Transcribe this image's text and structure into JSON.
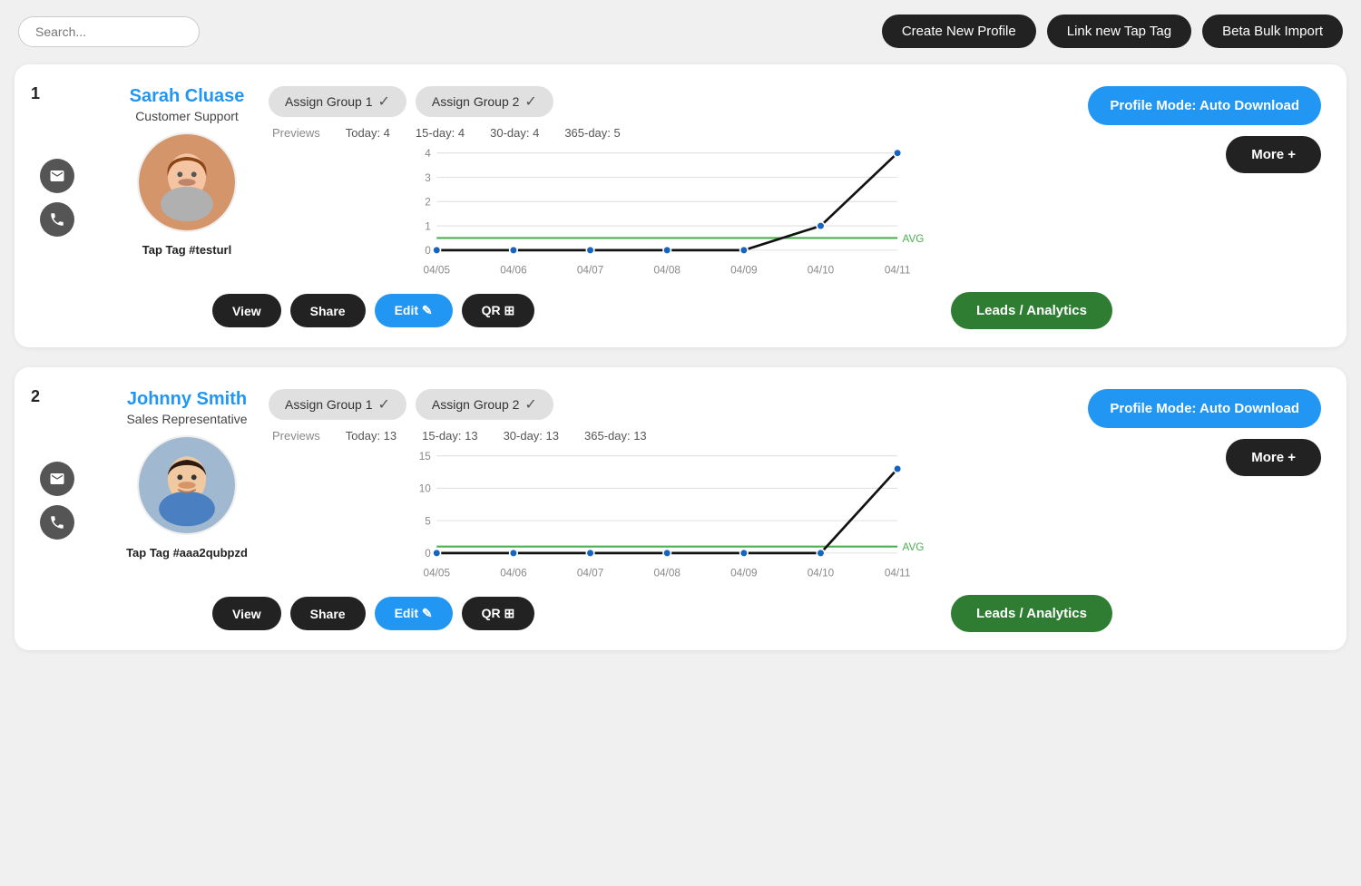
{
  "header": {
    "search_placeholder": "Search...",
    "btn_create": "Create New Profile",
    "btn_link": "Link new Tap Tag",
    "btn_bulk": "Beta Bulk Import"
  },
  "profiles": [
    {
      "number": "1",
      "name": "Sarah Cluase",
      "title": "Customer Support",
      "tap_tag": "Tap Tag #testurl",
      "group1": "Assign Group 1",
      "group2": "Assign Group 2",
      "stats": {
        "label": "Previews",
        "today": "Today: 4",
        "day15": "15-day: 4",
        "day30": "30-day: 4",
        "day365": "365-day: 5"
      },
      "profile_mode": "Profile Mode: Auto Download",
      "more": "More +",
      "btn_view": "View",
      "btn_share": "Share",
      "btn_edit": "Edit ✎",
      "btn_qr": "QR ⊞",
      "btn_leads": "Leads / Analytics",
      "chart": {
        "dates": [
          "04/05",
          "04/06",
          "04/07",
          "04/08",
          "04/09",
          "04/10",
          "04/11"
        ],
        "values": [
          0,
          0,
          0,
          0,
          0,
          1,
          4
        ],
        "avg": 0.5,
        "max": 4,
        "avg_label": "AVG"
      },
      "avatar_color": "#c8956c",
      "avatar_type": "woman"
    },
    {
      "number": "2",
      "name": "Johnny Smith",
      "title": "Sales Representative",
      "tap_tag": "Tap Tag #aaa2qubpzd",
      "group1": "Assign Group 1",
      "group2": "Assign Group 2",
      "stats": {
        "label": "Previews",
        "today": "Today: 13",
        "day15": "15-day: 13",
        "day30": "30-day: 13",
        "day365": "365-day: 13"
      },
      "profile_mode": "Profile Mode: Auto Download",
      "more": "More +",
      "btn_view": "View",
      "btn_share": "Share",
      "btn_edit": "Edit ✎",
      "btn_qr": "QR ⊞",
      "btn_leads": "Leads / Analytics",
      "chart": {
        "dates": [
          "04/05",
          "04/06",
          "04/07",
          "04/08",
          "04/09",
          "04/10",
          "04/11"
        ],
        "values": [
          0,
          0,
          0,
          0,
          0,
          0,
          13
        ],
        "avg": 1,
        "max": 15,
        "avg_label": "AVG"
      },
      "avatar_color": "#8fa8c8",
      "avatar_type": "man"
    }
  ]
}
